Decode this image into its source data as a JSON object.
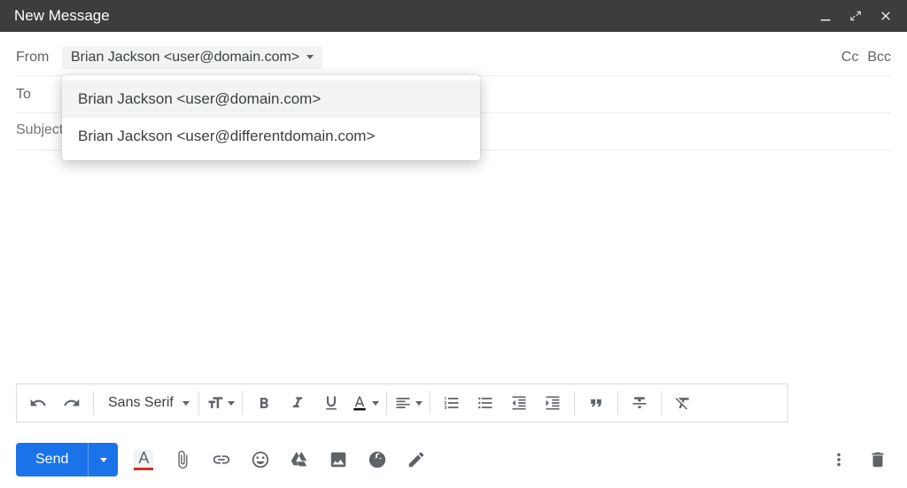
{
  "window": {
    "title": "New Message"
  },
  "fields": {
    "from_label": "From",
    "from_value": "Brian Jackson <user@domain.com>",
    "to_label": "To",
    "subject_placeholder": "Subject",
    "cc": "Cc",
    "bcc": "Bcc"
  },
  "from_dropdown": {
    "options": [
      "Brian Jackson <user@domain.com>",
      "Brian Jackson <user@differentdomain.com>"
    ]
  },
  "format": {
    "font_family": "Sans Serif"
  },
  "send": {
    "label": "Send"
  }
}
